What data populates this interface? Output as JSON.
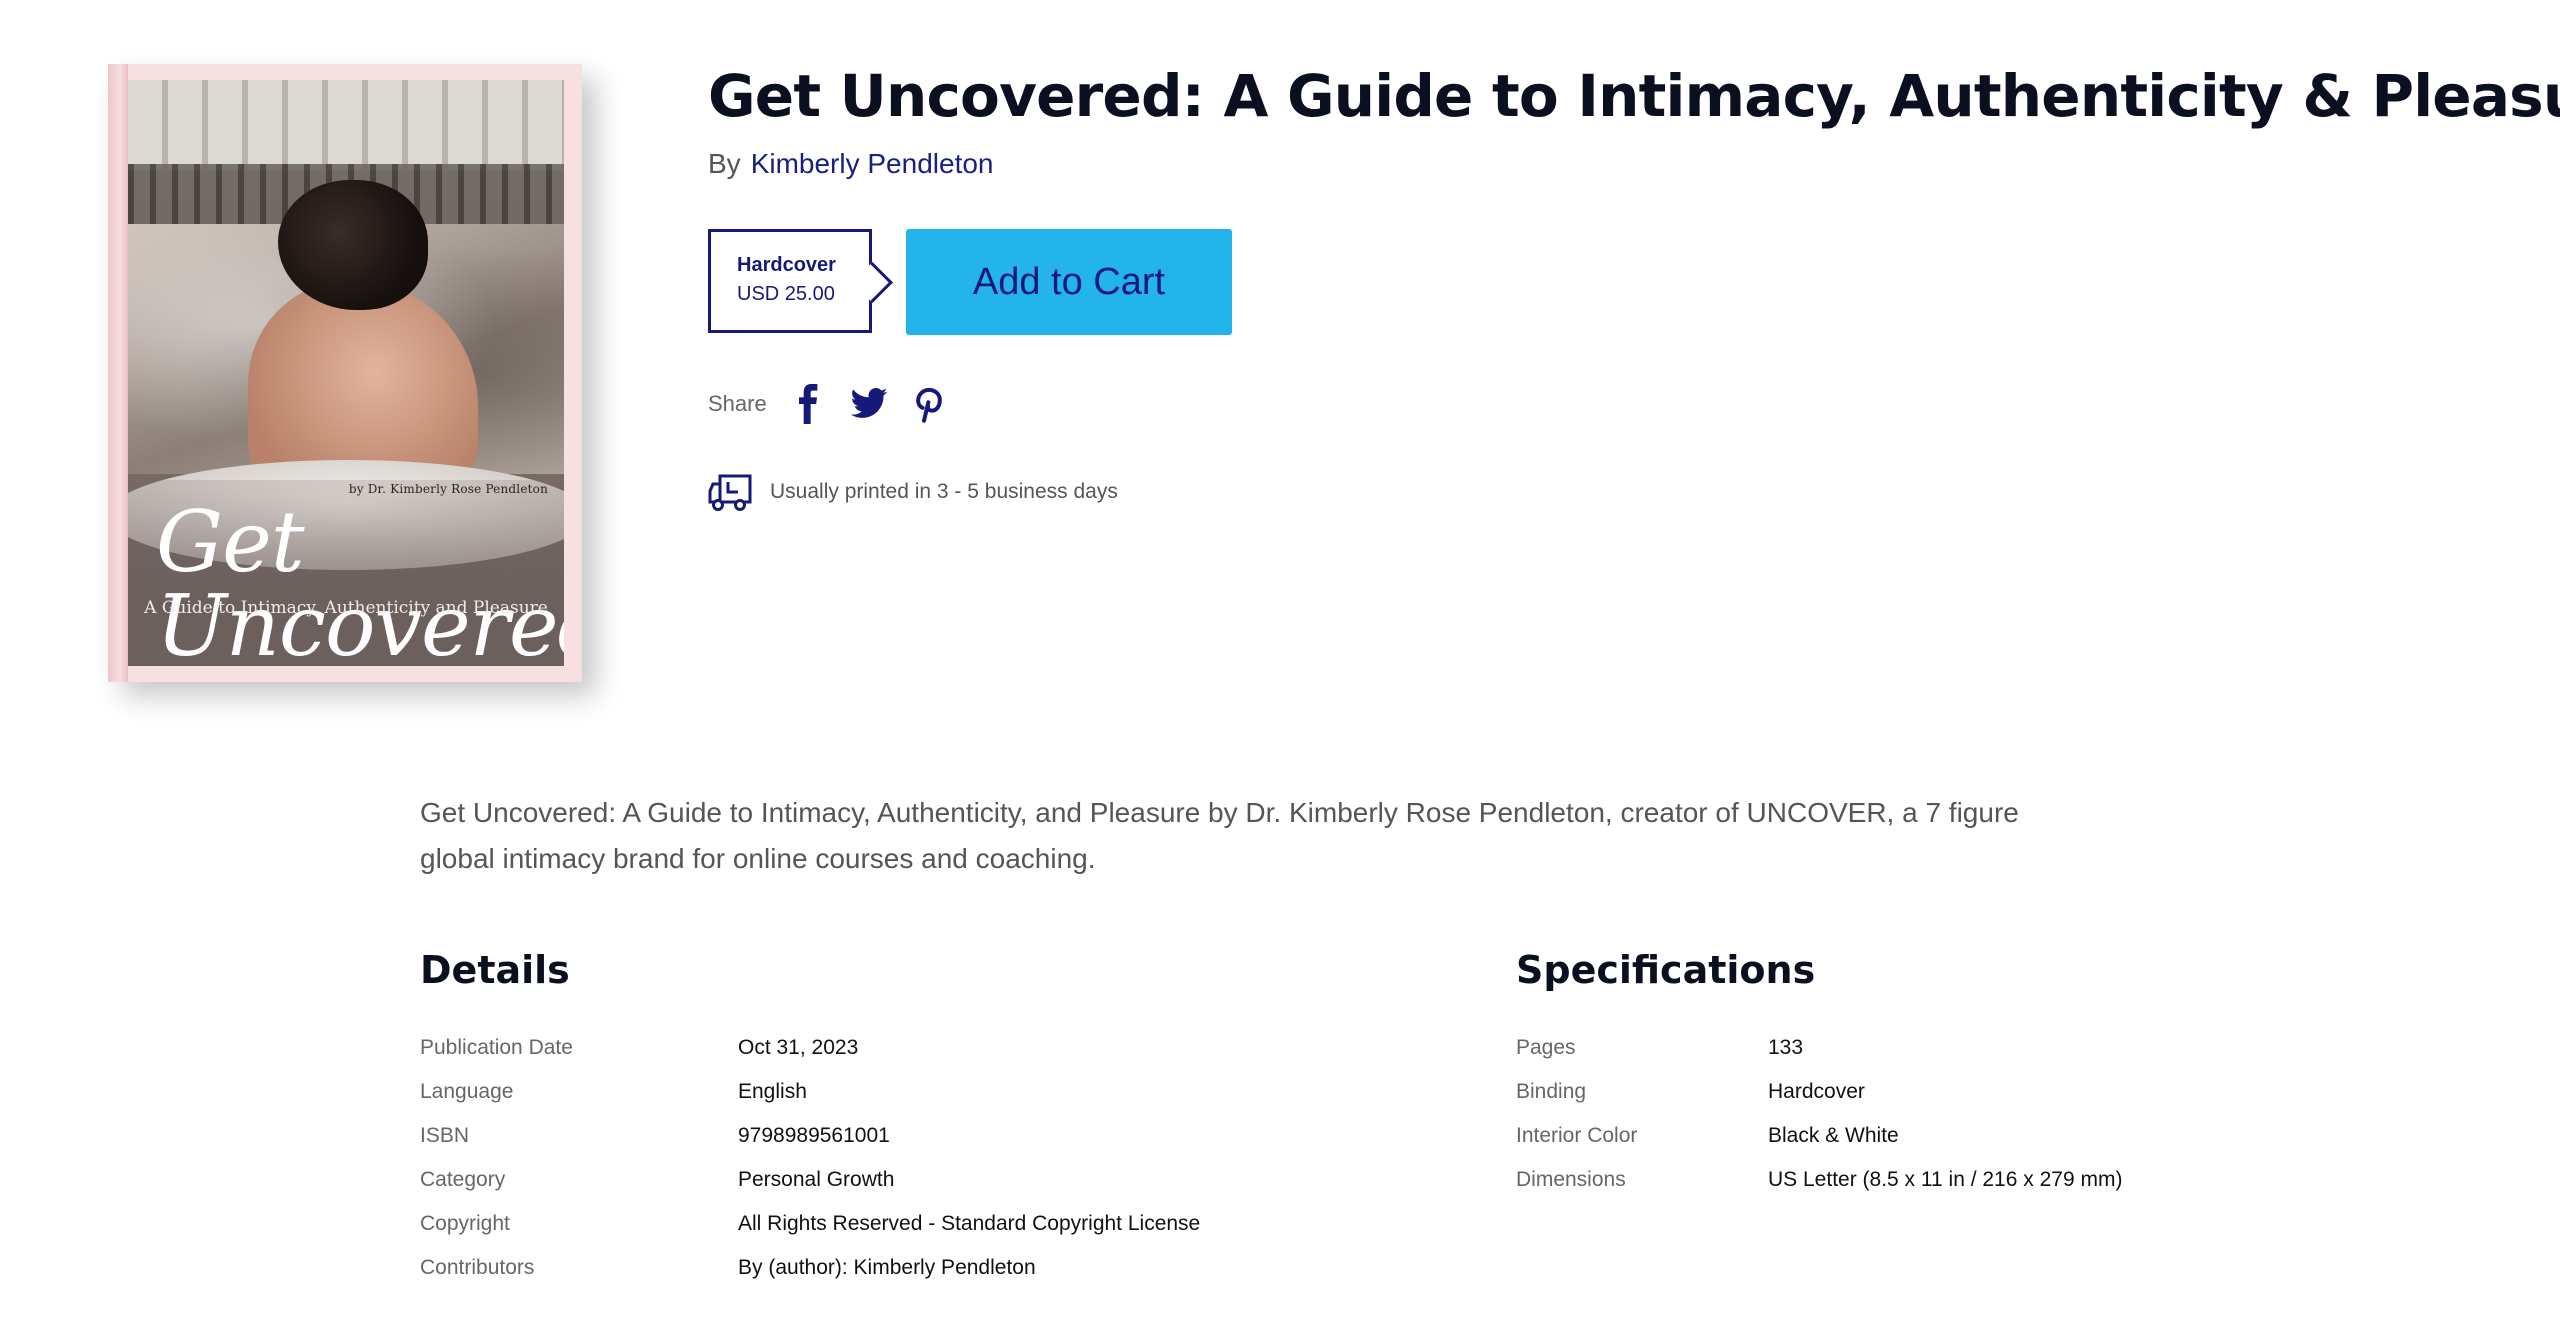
{
  "book": {
    "title": "Get Uncovered: A Guide to Intimacy, Authenticity & Pleasure",
    "by_label": "By",
    "author": "Kimberly Pendleton"
  },
  "cover": {
    "byline": "by Dr. Kimberly Rose Pendleton",
    "title": "Get Uncovered",
    "subtitle": "A Guide to Intimacy, Authenticity and Pleasure"
  },
  "format": {
    "name": "Hardcover",
    "price": "USD 25.00"
  },
  "cart": {
    "label": "Add to Cart",
    "color": "#22b4ea"
  },
  "share": {
    "label": "Share",
    "icons": [
      "facebook-icon",
      "twitter-icon",
      "pinterest-icon"
    ]
  },
  "shipping": {
    "text": "Usually printed in 3 - 5 business days"
  },
  "description": "Get Uncovered: A Guide to Intimacy, Authenticity, and Pleasure by Dr. Kimberly Rose Pendleton, creator of UNCOVER, a 7 figure global intimacy brand for online courses and coaching.",
  "details": {
    "title": "Details",
    "rows": [
      {
        "label": "Publication Date",
        "value": "Oct 31, 2023"
      },
      {
        "label": "Language",
        "value": "English"
      },
      {
        "label": "ISBN",
        "value": "9798989561001"
      },
      {
        "label": "Category",
        "value": "Personal Growth"
      },
      {
        "label": "Copyright",
        "value": "All Rights Reserved - Standard Copyright License"
      },
      {
        "label": "Contributors",
        "value": "By (author): Kimberly Pendleton"
      }
    ]
  },
  "specifications": {
    "title": "Specifications",
    "rows": [
      {
        "label": "Pages",
        "value": "133"
      },
      {
        "label": "Binding",
        "value": "Hardcover"
      },
      {
        "label": "Interior Color",
        "value": "Black & White"
      },
      {
        "label": "Dimensions",
        "value": "US Letter (8.5 x 11 in / 216 x 279 mm)"
      }
    ]
  },
  "colors": {
    "brand_navy": "#15197a",
    "accent_blue": "#22b4ea"
  }
}
